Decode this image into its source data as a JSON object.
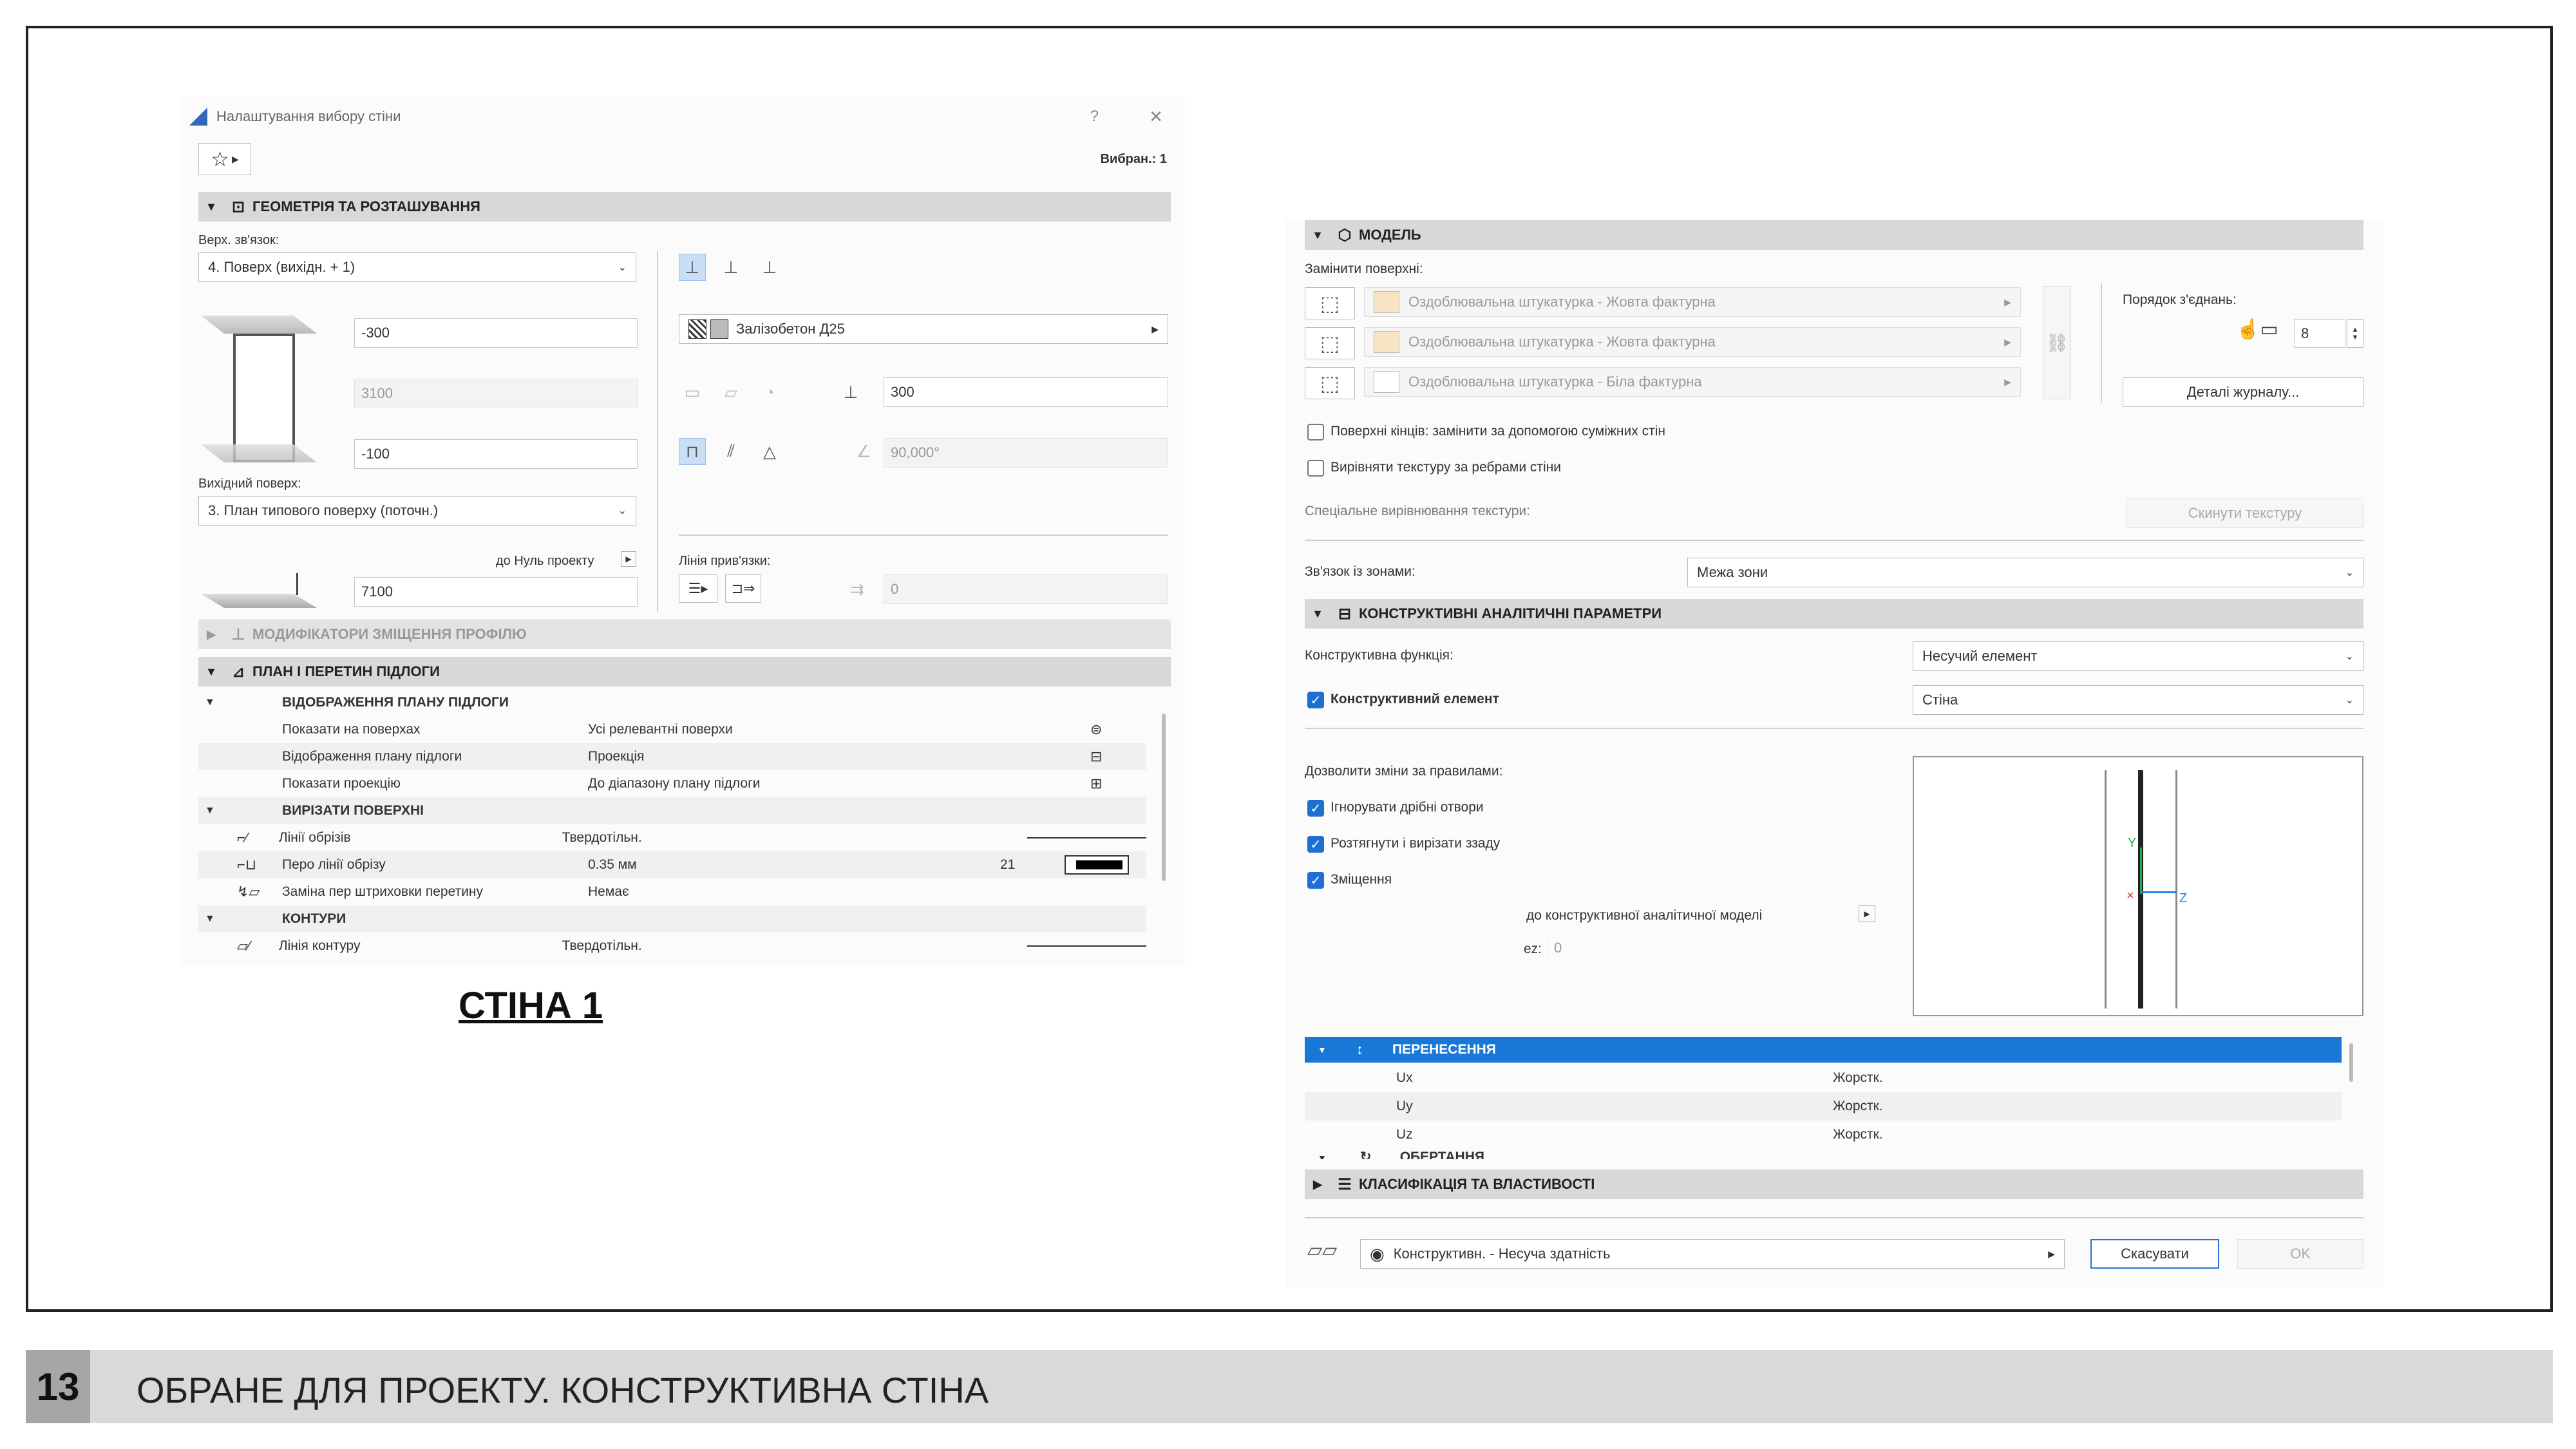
{
  "dialog1": {
    "title": "Налаштування вибору стіни",
    "help": "?",
    "close": "✕",
    "selected": "Вибран.: 1",
    "sec_geometry": "ГЕОМЕТРІЯ ТА РОЗТАШУВАННЯ",
    "top_link_label": "Верх. зв'язок:",
    "top_link_value": "4. Поверх (вихідн. + 1)",
    "top_offset": "-300",
    "height": "3100",
    "bottom_offset": "-100",
    "home_story_label": "Вихідний поверх:",
    "home_story_value": "3. План типового поверху (поточн.)",
    "to_project_zero": "до Нуль проекту",
    "elevation": "7100",
    "material": "Залізобетон Д25",
    "thickness": "300",
    "angle": "90,000°",
    "ref_line_label": "Лінія прив'язки:",
    "ref_offset": "0",
    "sec_profile": "МОДИФІКАТОРИ ЗМІЩЕННЯ ПРОФІЛЮ",
    "sec_plan": "ПЛАН І ПЕРЕТИН ПІДЛОГИ",
    "rows": [
      {
        "label": "ВІДОБРАЖЕННЯ ПЛАНУ ПІДЛОГИ",
        "value": "",
        "extra": "",
        "group": true
      },
      {
        "label": "Показати на поверхах",
        "value": "Усі релевантні поверхи",
        "extra": "",
        "group": false
      },
      {
        "label": "Відображення плану підлоги",
        "value": "Проекція",
        "extra": "",
        "group": false
      },
      {
        "label": "Показати проекцію",
        "value": "До діапазону плану підлоги",
        "extra": "",
        "group": false
      },
      {
        "label": "ВИРІЗАТИ ПОВЕРХНІ",
        "value": "",
        "extra": "",
        "group": true
      },
      {
        "label": "Лінії обрізів",
        "value": "Твердотільн.",
        "extra": "",
        "group": false
      },
      {
        "label": "Перо лінії обрізу",
        "value": "0.35 мм",
        "extra": "21",
        "group": false
      },
      {
        "label": "Заміна пер штриховки перетину",
        "value": "Немає",
        "extra": "",
        "group": false
      },
      {
        "label": "КОНТУРИ",
        "value": "",
        "extra": "",
        "group": true
      },
      {
        "label": "Лінія контуру",
        "value": "Твердотільн.",
        "extra": "",
        "group": false
      }
    ]
  },
  "caption": "СТІНА 1",
  "dialog2": {
    "sec_model": "МОДЕЛЬ",
    "override_label": "Замінити поверхні:",
    "surfaces": [
      {
        "name": "Оздоблювальна штукатурка - Жовта фактурна",
        "swatch": "#f7e4c3"
      },
      {
        "name": "Оздоблювальна штукатурка - Жовта фактурна",
        "swatch": "#f7e4c3"
      },
      {
        "name": "Оздоблювальна штукатурка - Біла фактурна",
        "swatch": "#ffffff"
      }
    ],
    "join_order_label": "Порядок з'єднань:",
    "join_order_value": "8",
    "log_details": "Деталі журналу...",
    "end_surfaces": "Поверхні кінців: замінити за допомогою суміжних стін",
    "align_texture": "Вирівняти текстуру за ребрами стіни",
    "special_align": "Спеціальне вирівнювання текстури:",
    "reset_texture": "Скинути текстуру",
    "zones_label": "Зв'язок із зонами:",
    "zones_value": "Межа зони",
    "sec_structural": "КОНСТРУКТИВНІ АНАЛІТИЧНІ ПАРАМЕТРИ",
    "struct_func_label": "Конструктивна функція:",
    "struct_func_value": "Несучий елемент",
    "struct_elem_label": "Конструктивний елемент",
    "struct_elem_value": "Стіна",
    "allow_changes": "Дозволити зміни за правилами:",
    "ignore_openings": "Ігнорувати дрібні отвори",
    "extend_cut": "Розтягнути і вирізати ззаду",
    "offset": "Зміщення",
    "to_model": "до конструктивної аналітичної моделі",
    "ez_label": "ez:",
    "ez_value": "0",
    "axis_y": "Y",
    "axis_z": "Z",
    "axis_x": "×",
    "transfer_header": "ПЕРЕНЕСЕННЯ",
    "transfers": [
      {
        "axis": "Ux",
        "value": "Жорстк."
      },
      {
        "axis": "Uy",
        "value": "Жорстк."
      },
      {
        "axis": "Uz",
        "value": "Жорстк."
      }
    ],
    "rotation_partial": "ОБЕРТАННЯ",
    "sec_class": "КЛАСИФІКАЦІЯ ТА ВЛАСТИВОСТІ",
    "layer": "Конструктивн. - Несуча здатність",
    "cancel": "Скасувати",
    "ok": "OK"
  },
  "footer": {
    "page_number": "13",
    "title": "ОБРАНЕ ДЛЯ ПРОЕКТУ. КОНСТРУКТИВНА СТІНА"
  }
}
